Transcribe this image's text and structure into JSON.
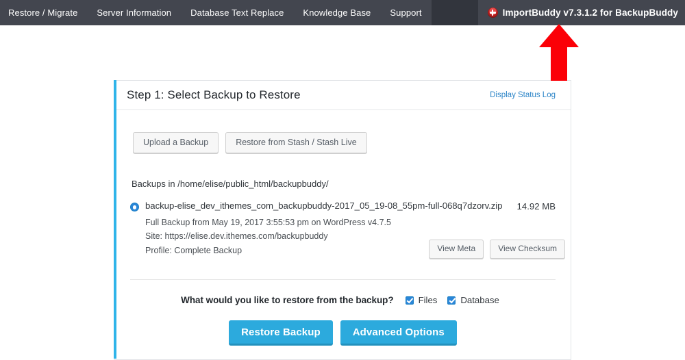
{
  "adminbar": {
    "menu_items": [
      {
        "label": "Restore / Migrate"
      },
      {
        "label": "Server Information"
      },
      {
        "label": "Database Text Replace"
      },
      {
        "label": "Knowledge Base"
      },
      {
        "label": "Support"
      }
    ],
    "brand": {
      "icon": "backupbuddy-logo-icon",
      "text": "ImportBuddy v7.3.1.2 for BackupBuddy"
    }
  },
  "annotation": {
    "arrow": "red-up-arrow",
    "color": "#fb0007"
  },
  "panel": {
    "accent_color": "#2fb4e9",
    "title": "Step 1: Select Backup to Restore",
    "status_log_link": "Display Status Log",
    "top_buttons": [
      {
        "label": "Upload a Backup",
        "name": "upload-a-backup-button"
      },
      {
        "label": "Restore from Stash / Stash Live",
        "name": "restore-from-stash-button"
      }
    ],
    "backups_path_label": "Backups in /home/elise/public_html/backupbuddy/",
    "backup": {
      "selected": true,
      "filename": "backup-elise_dev_ithemes_com_backupbuddy-2017_05_19-08_55pm-full-068q7dzorv.zip",
      "size": "14.92 MB",
      "meta_lines": [
        "Full Backup from May 19, 2017 3:55:53 pm on WordPress v4.7.5",
        "Site: https://elise.dev.ithemes.com/backupbuddy",
        "Profile: Complete Backup"
      ],
      "meta_buttons": [
        {
          "label": "View Meta",
          "name": "view-meta-button"
        },
        {
          "label": "View Checksum",
          "name": "view-checksum-button"
        }
      ]
    },
    "restore_question": "What would you like to restore from the backup?",
    "restore_options": [
      {
        "label": "Files",
        "checked": true,
        "name": "files-checkbox"
      },
      {
        "label": "Database",
        "checked": true,
        "name": "database-checkbox"
      }
    ],
    "primary_buttons": [
      {
        "label": "Restore Backup",
        "name": "restore-backup-button"
      },
      {
        "label": "Advanced Options",
        "name": "advanced-options-button"
      }
    ]
  }
}
